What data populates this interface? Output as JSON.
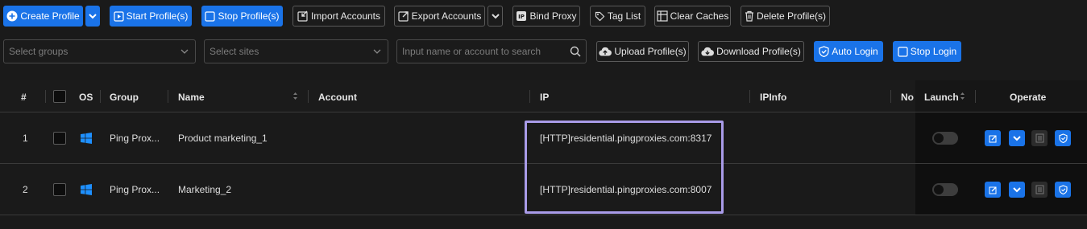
{
  "toolbar": {
    "create_profile": "Create Profile",
    "start_profiles": "Start Profile(s)",
    "stop_profiles": "Stop Profile(s)",
    "import_accounts": "Import Accounts",
    "export_accounts": "Export Accounts",
    "bind_proxy": "Bind Proxy",
    "tag_list": "Tag List",
    "clear_caches": "Clear Caches",
    "delete_profiles": "Delete Profile(s)"
  },
  "filters": {
    "groups_placeholder": "Select groups",
    "sites_placeholder": "Select sites",
    "search_placeholder": "Input name or account to search",
    "upload_profiles": "Upload Profile(s)",
    "download_profiles": "Download Profile(s)",
    "auto_login": "Auto Login",
    "stop_login": "Stop Login"
  },
  "table": {
    "headers": {
      "index": "#",
      "os": "OS",
      "group": "Group",
      "name": "Name",
      "account": "Account",
      "ip": "IP",
      "ipinfo": "IPInfo",
      "notes": "No",
      "launch": "Launch",
      "operate": "Operate"
    },
    "rows": [
      {
        "index": "1",
        "group": "Ping Prox...",
        "name": "Product marketing_1",
        "account": "",
        "ip": "[HTTP]residential.pingproxies.com:8317",
        "ipinfo": "",
        "launched": false
      },
      {
        "index": "2",
        "group": "Ping Prox...",
        "name": "Marketing_2",
        "account": "",
        "ip": "[HTTP]residential.pingproxies.com:8007",
        "ipinfo": "",
        "launched": false
      }
    ]
  },
  "colors": {
    "accent": "#1a73e8",
    "highlight": "#a99be8",
    "windows": "#1e90ff"
  }
}
